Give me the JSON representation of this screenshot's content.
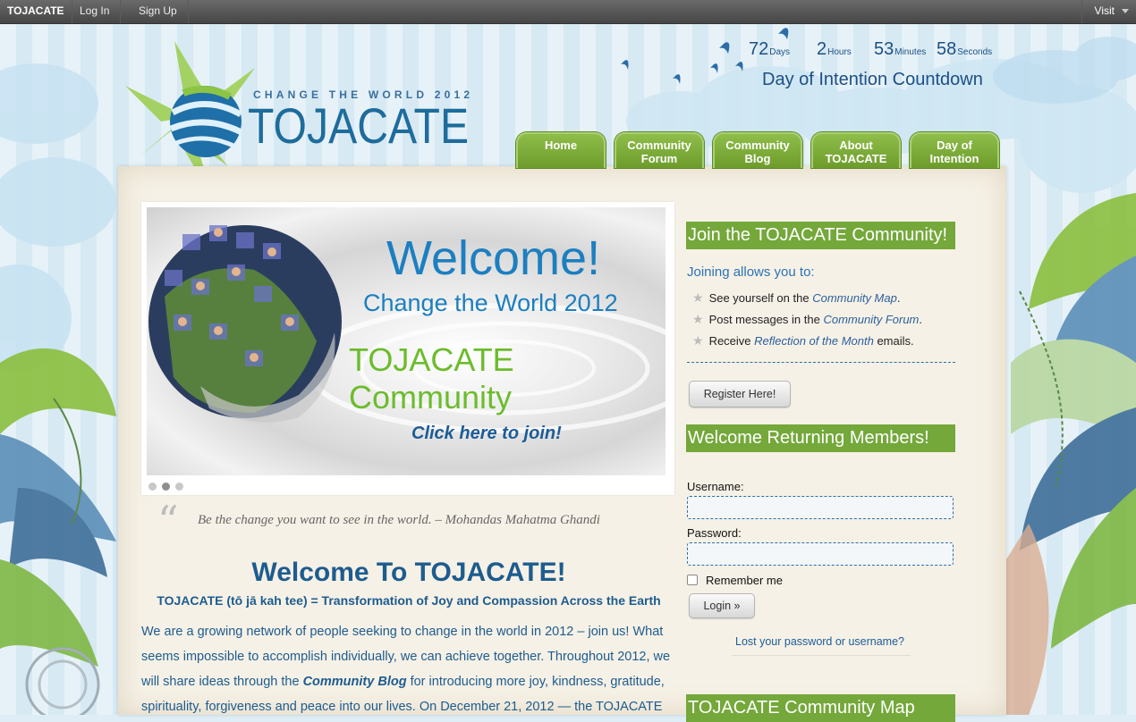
{
  "adminbar": {
    "site": "TOJACATE",
    "login": "Log In",
    "signup": "Sign Up",
    "visit": "Visit"
  },
  "logo": {
    "tagline": "CHANGE THE WORLD 2012",
    "name": "TOJACATE"
  },
  "countdown": {
    "days": "72",
    "days_unit": "Days",
    "hours": "2",
    "hours_unit": "Hours",
    "minutes": "53",
    "minutes_unit": "Minutes",
    "seconds": "58",
    "seconds_unit": "Seconds",
    "title": "Day of Intention Countdown"
  },
  "nav": {
    "home": [
      "Home",
      ""
    ],
    "forum": [
      "Community",
      "Forum"
    ],
    "blog": [
      "Community",
      "Blog"
    ],
    "about": [
      "About",
      "TOJACATE"
    ],
    "day": [
      "Day of",
      "Intention"
    ]
  },
  "slider": {
    "welcome": "Welcome!",
    "subtitle": "Change the World 2012",
    "community": "TOJACATE Community",
    "join": "Click here to join!"
  },
  "quote": "Be the change you want to see in the world. – Mohandas Mahatma Ghandi",
  "main": {
    "title": "Welcome To TOJACATE!",
    "subtitle": "TOJACATE (tō jā kah tee) = Transformation of Joy and Compassion Across the Earth",
    "para_1": "We are a growing network of people seeking to change in the world in 2012 – join us! What seems impossible to accomplish individually, we can achieve together. Throughout 2012, we will share ideas through the ",
    "para_link": "Community Blog",
    "para_2": " for introducing more joy, kindness, gratitude, spirituality, forgiveness and peace into our lives. On December 21, 2012 — the TOJACATE"
  },
  "sidebar": {
    "join_heading": "Join the TOJACATE Community!",
    "joining_allows": "Joining allows you to:",
    "benefits": [
      {
        "pre": "See yourself on the ",
        "link": "Community Map",
        "post": "."
      },
      {
        "pre": "Post messages in the ",
        "link": "Community Forum",
        "post": "."
      },
      {
        "pre": "Receive ",
        "link": "Reflection of the Month",
        "post": " emails."
      }
    ],
    "register": "Register Here!",
    "welcome_heading": "Welcome Returning Members!",
    "username_label": "Username:",
    "username_value": "",
    "password_label": "Password:",
    "password_value": "",
    "remember": "Remember me",
    "login": "Login »",
    "lost": "Lost your password or username?",
    "map_heading": "TOJACATE Community Map"
  },
  "colors": {
    "accent_green": "#74a83a",
    "text_blue": "#1d5c8f",
    "link_blue": "#2a73b8"
  }
}
